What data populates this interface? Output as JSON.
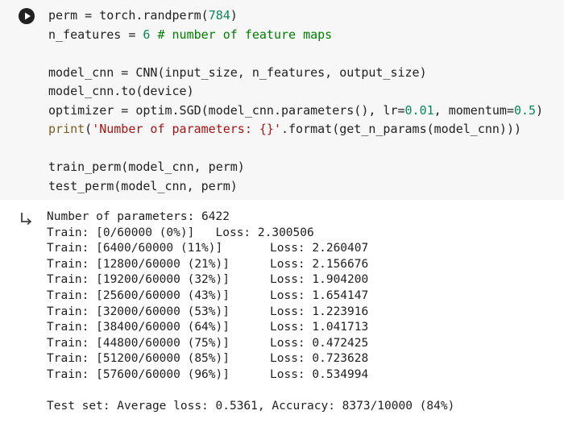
{
  "code_cell": {
    "lines": [
      [
        "perm",
        " = ",
        "torch.randperm(",
        "784",
        ")"
      ],
      [
        "n_features",
        " = ",
        "6",
        " ",
        "# number of feature maps"
      ],
      [
        "model_cnn",
        " = ",
        "CNN(input_size, n_features, output_size)"
      ],
      [
        "model_cnn.to(device)"
      ],
      [
        "optimizer",
        " = ",
        "optim.SGD(model_cnn.parameters(), lr=",
        "0.01",
        ", momentum=",
        "0.5",
        ")"
      ],
      [
        "print",
        "(",
        "'Number of parameters: {}'",
        ".format(get_n_params(model_cnn)))"
      ],
      [
        "train_perm(model_cnn, perm)"
      ],
      [
        "test_perm(model_cnn, perm)"
      ]
    ]
  },
  "output": {
    "params_line": "Number of parameters: 6422",
    "first_train": "Train: [0/60000 (0%)]   Loss: 2.300506",
    "train_rows": [
      {
        "progress": "Train: [6400/60000 (11%)]",
        "loss": "Loss: 2.260407"
      },
      {
        "progress": "Train: [12800/60000 (21%)]",
        "loss": "Loss: 2.156676"
      },
      {
        "progress": "Train: [19200/60000 (32%)]",
        "loss": "Loss: 1.904200"
      },
      {
        "progress": "Train: [25600/60000 (43%)]",
        "loss": "Loss: 1.654147"
      },
      {
        "progress": "Train: [32000/60000 (53%)]",
        "loss": "Loss: 1.223916"
      },
      {
        "progress": "Train: [38400/60000 (64%)]",
        "loss": "Loss: 1.041713"
      },
      {
        "progress": "Train: [44800/60000 (75%)]",
        "loss": "Loss: 0.472425"
      },
      {
        "progress": "Train: [51200/60000 (85%)]",
        "loss": "Loss: 0.723628"
      },
      {
        "progress": "Train: [57600/60000 (96%)]",
        "loss": "Loss: 0.534994"
      }
    ],
    "test_line": "Test set: Average loss: 0.5361, Accuracy: 8373/10000 (84%)"
  },
  "icons": {
    "run": "play-circle-icon",
    "output": "output-arrow-icon"
  }
}
